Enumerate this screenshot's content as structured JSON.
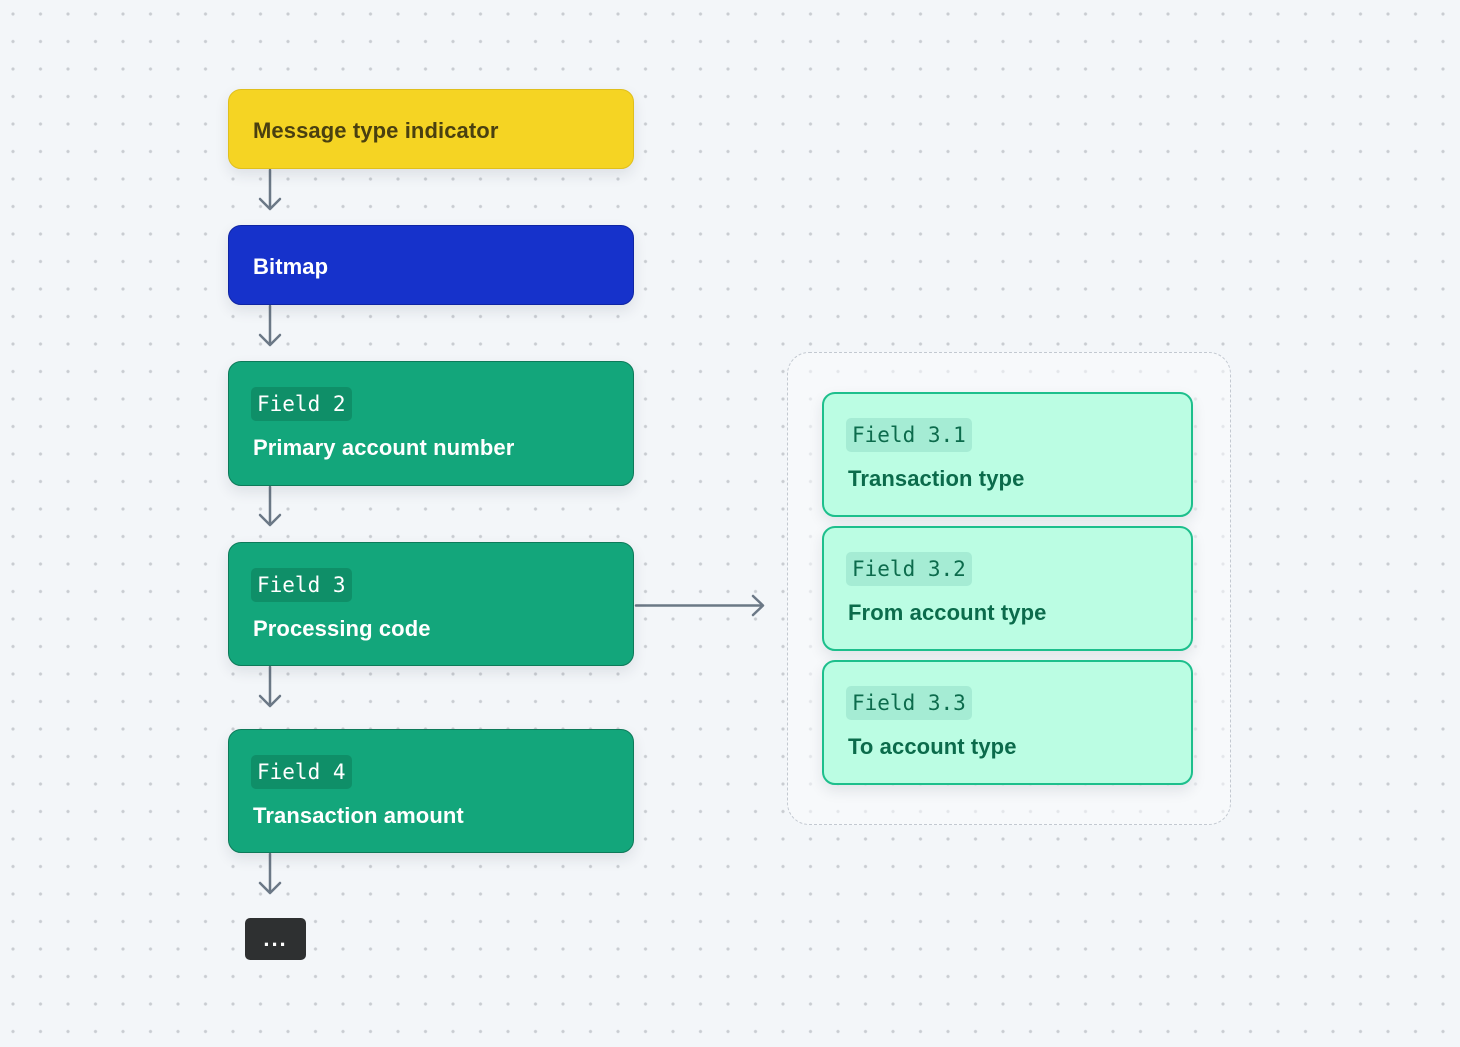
{
  "diagram": {
    "flow": [
      {
        "id": "mti",
        "title": "Message type indicator",
        "color": "#f5d423"
      },
      {
        "id": "bitmap",
        "title": "Bitmap",
        "color": "#1632cb"
      },
      {
        "id": "field-2",
        "tag": "Field 2",
        "title": "Primary account number",
        "color": "#13a67b"
      },
      {
        "id": "field-3",
        "tag": "Field 3",
        "title": "Processing code",
        "color": "#13a67b"
      },
      {
        "id": "field-4",
        "tag": "Field 4",
        "title": "Transaction amount",
        "color": "#13a67b"
      }
    ],
    "continuation": {
      "label": "..."
    },
    "subfields": [
      {
        "id": "field-3-1",
        "tag": "Field 3.1",
        "title": "Transaction type",
        "color": "#bbfde3"
      },
      {
        "id": "field-3-2",
        "tag": "Field 3.2",
        "title": "From account type",
        "color": "#bbfde3"
      },
      {
        "id": "field-3-3",
        "tag": "Field 3.3",
        "title": "To account type",
        "color": "#bbfde3"
      }
    ],
    "edges": [
      {
        "from": "mti",
        "to": "bitmap"
      },
      {
        "from": "bitmap",
        "to": "field-2"
      },
      {
        "from": "field-2",
        "to": "field-3"
      },
      {
        "from": "field-3",
        "to": "field-4"
      },
      {
        "from": "field-4",
        "to": "continuation"
      },
      {
        "from": "field-3",
        "to": "subfields-group"
      }
    ],
    "colors": {
      "arrow": "#6b7886",
      "background": "#f3f6f9",
      "group_border": "#c3c9d1"
    }
  }
}
